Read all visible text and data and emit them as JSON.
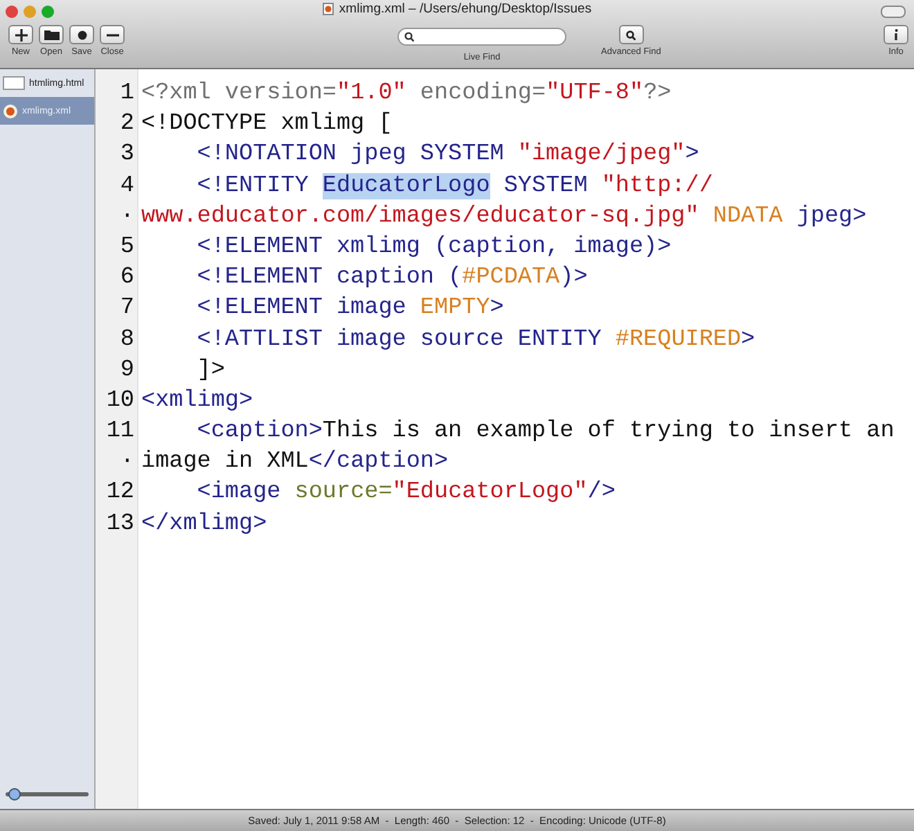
{
  "window": {
    "title": "xmlimg.xml – /Users/ehung/Desktop/Issues"
  },
  "toolbar": {
    "buttons": [
      {
        "label": "New",
        "kind": "plus"
      },
      {
        "label": "Open",
        "kind": "folder"
      },
      {
        "label": "Save",
        "kind": "dot"
      },
      {
        "label": "Close",
        "kind": "minus"
      }
    ],
    "live_find": {
      "label": "Live Find"
    },
    "advanced_find": {
      "label": "Advanced Find"
    },
    "info": {
      "label": "Info"
    }
  },
  "sidebar": {
    "items": [
      {
        "name": "htmlimg.html",
        "kind": "html",
        "selected": false
      },
      {
        "name": "xmlimg.xml",
        "kind": "xml",
        "selected": true
      }
    ],
    "zoom_slider": {
      "level": 0.12
    }
  },
  "editor": {
    "rows": [
      {
        "number": "1",
        "tokens": [
          {
            "text": "<?xml version=",
            "kind": "pi"
          },
          {
            "text": "\"1.0\"",
            "kind": "string"
          },
          {
            "text": " encoding=",
            "kind": "pi"
          },
          {
            "text": "\"UTF-8\"",
            "kind": "string"
          },
          {
            "text": "?>",
            "kind": "pi"
          }
        ]
      },
      {
        "number": "2",
        "tokens": [
          {
            "text": "<!DOCTYPE xmlimg [",
            "kind": "plain"
          }
        ]
      },
      {
        "number": "3",
        "tokens": [
          {
            "text": "    <!NOTATION jpeg SYSTEM ",
            "kind": "tag"
          },
          {
            "text": "\"image/jpeg\"",
            "kind": "string"
          },
          {
            "text": ">",
            "kind": "tag"
          }
        ]
      },
      {
        "number": "4",
        "tokens": [
          {
            "text": "    <!ENTITY ",
            "kind": "tag"
          },
          {
            "text": "EducatorLogo",
            "kind": "highlight"
          },
          {
            "text": " SYSTEM ",
            "kind": "tag"
          },
          {
            "text": "\"http://",
            "kind": "string"
          }
        ]
      },
      {
        "number": "·",
        "tokens": [
          {
            "text": "www.educator.com/images/educator-sq.jpg\"",
            "kind": "string"
          },
          {
            "text": " NDATA",
            "kind": "keyword"
          },
          {
            "text": " jpeg>",
            "kind": "tag"
          }
        ]
      },
      {
        "number": "5",
        "tokens": [
          {
            "text": "    <!ELEMENT xmlimg (caption, image)>",
            "kind": "tag"
          }
        ]
      },
      {
        "number": "6",
        "tokens": [
          {
            "text": "    <!ELEMENT caption (",
            "kind": "tag"
          },
          {
            "text": "#PCDATA",
            "kind": "keyword"
          },
          {
            "text": ")>",
            "kind": "tag"
          }
        ]
      },
      {
        "number": "7",
        "tokens": [
          {
            "text": "    <!ELEMENT image ",
            "kind": "tag"
          },
          {
            "text": "EMPTY",
            "kind": "keyword"
          },
          {
            "text": ">",
            "kind": "tag"
          }
        ]
      },
      {
        "number": "8",
        "tokens": [
          {
            "text": "    <!ATTLIST image source ENTITY ",
            "kind": "tag"
          },
          {
            "text": "#REQUIRED",
            "kind": "keyword"
          },
          {
            "text": ">",
            "kind": "tag"
          }
        ]
      },
      {
        "number": "9",
        "tokens": [
          {
            "text": "    ]>",
            "kind": "plain"
          }
        ]
      },
      {
        "number": "10",
        "tokens": [
          {
            "text": "<xmlimg>",
            "kind": "tag"
          }
        ]
      },
      {
        "number": "11",
        "tokens": [
          {
            "text": "    <caption>",
            "kind": "tag"
          },
          {
            "text": "This is an example of trying to insert an",
            "kind": "plain"
          }
        ]
      },
      {
        "number": "·",
        "tokens": [
          {
            "text": "image in XML",
            "kind": "plain"
          },
          {
            "text": "</caption>",
            "kind": "tag"
          }
        ]
      },
      {
        "number": "12",
        "tokens": [
          {
            "text": "    <image ",
            "kind": "tag"
          },
          {
            "text": "source=",
            "kind": "attr"
          },
          {
            "text": "\"EducatorLogo\"",
            "kind": "string"
          },
          {
            "text": "/>",
            "kind": "tag"
          }
        ]
      },
      {
        "number": "13",
        "tokens": [
          {
            "text": "</xmlimg>",
            "kind": "tag"
          }
        ]
      }
    ]
  },
  "status_bar": {
    "text": "Saved: July 1, 2011 9:58 AM  -  Length: 460  -  Selection: 12  -  Encoding: Unicode (UTF-8)"
  }
}
